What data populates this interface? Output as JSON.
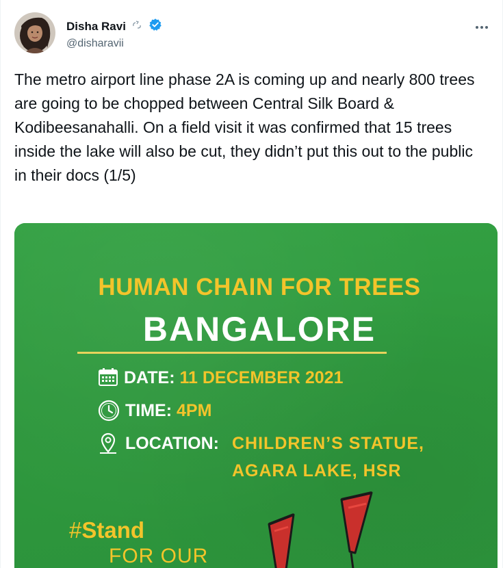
{
  "user": {
    "display_name": "Disha Ravi",
    "handle": "@disharavii",
    "icons": [
      "recycle-badge-icon",
      "verified-badge-icon"
    ]
  },
  "menu": {
    "more_icon": "more-options-icon"
  },
  "tweet": {
    "text": "The metro airport line phase 2A is coming up and nearly 800 trees are going to be chopped between Central Silk Board & Kodibeesanahalli. On a field visit it was confirmed that 15 trees inside the lake will also be cut, they didn’t put this out to the public in their docs (1/5)"
  },
  "poster": {
    "title": "HUMAN CHAIN FOR TREES",
    "city": "BANGALORE",
    "date_label": "DATE:",
    "date_value": "11 DECEMBER 2021",
    "time_label": "TIME:",
    "time_value": "4PM",
    "location_label": "LOCATION:",
    "location_line1": "CHILDREN’S STATUE,",
    "location_line2": "AGARA LAKE, HSR",
    "hashtag_symbol": "#",
    "hashtag_word": "Stand",
    "tagline": "FOR OUR",
    "icons": [
      "calendar-icon",
      "clock-icon",
      "location-pin-icon"
    ]
  },
  "colors": {
    "poster_green": "#2f9a3e",
    "poster_yellow": "#f3c42b",
    "verified_blue": "#1d9bf0",
    "text_primary": "#0f1419",
    "text_secondary": "#536471"
  }
}
